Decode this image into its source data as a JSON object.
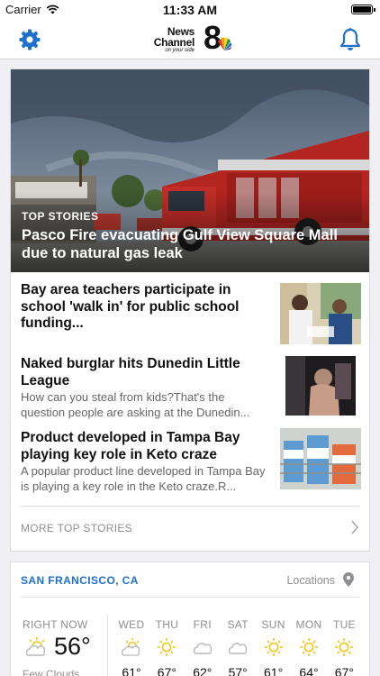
{
  "status": {
    "carrier": "Carrier",
    "time": "11:33 AM"
  },
  "nav": {
    "logo_news": "News",
    "logo_channel": "Channel",
    "logo_number": "8",
    "logo_tagline": "on your side"
  },
  "hero": {
    "kicker": "TOP STORIES",
    "title": "Pasco Fire evacuating Gulf View Square Mall due to natural gas leak"
  },
  "stories": [
    {
      "title": "Bay area teachers participate in school 'walk in' for public school funding...",
      "summary": ""
    },
    {
      "title": "Naked burglar hits Dunedin Little League",
      "summary": "How can you steal from kids?That's the question people are asking at the Dunedin..."
    },
    {
      "title": "Product developed in Tampa Bay playing key role in Keto craze",
      "summary": "A popular product line developed in Tampa Bay is playing a key role in the Keto craze.R..."
    }
  ],
  "more_label": "MORE TOP STORIES",
  "weather": {
    "city": "SAN FRANCISCO, CA",
    "locations_label": "Locations",
    "now_label": "RIGHT NOW",
    "now_temp": "56°",
    "now_condition": "Few Clouds",
    "days": [
      {
        "name": "WED",
        "temp": "61°",
        "icon": "partly-sunny-icon"
      },
      {
        "name": "THU",
        "temp": "67°",
        "icon": "sun-icon"
      },
      {
        "name": "FRI",
        "temp": "62°",
        "icon": "cloud-icon"
      },
      {
        "name": "SAT",
        "temp": "57°",
        "icon": "cloud-icon"
      },
      {
        "name": "SUN",
        "temp": "61°",
        "icon": "sun-icon"
      },
      {
        "name": "MON",
        "temp": "64°",
        "icon": "sun-icon"
      },
      {
        "name": "TUE",
        "temp": "67°",
        "icon": "sun-icon"
      }
    ]
  },
  "colors": {
    "accent": "#1e6fd0",
    "sun": "#f5c518",
    "cloud": "#b8b8bd"
  }
}
